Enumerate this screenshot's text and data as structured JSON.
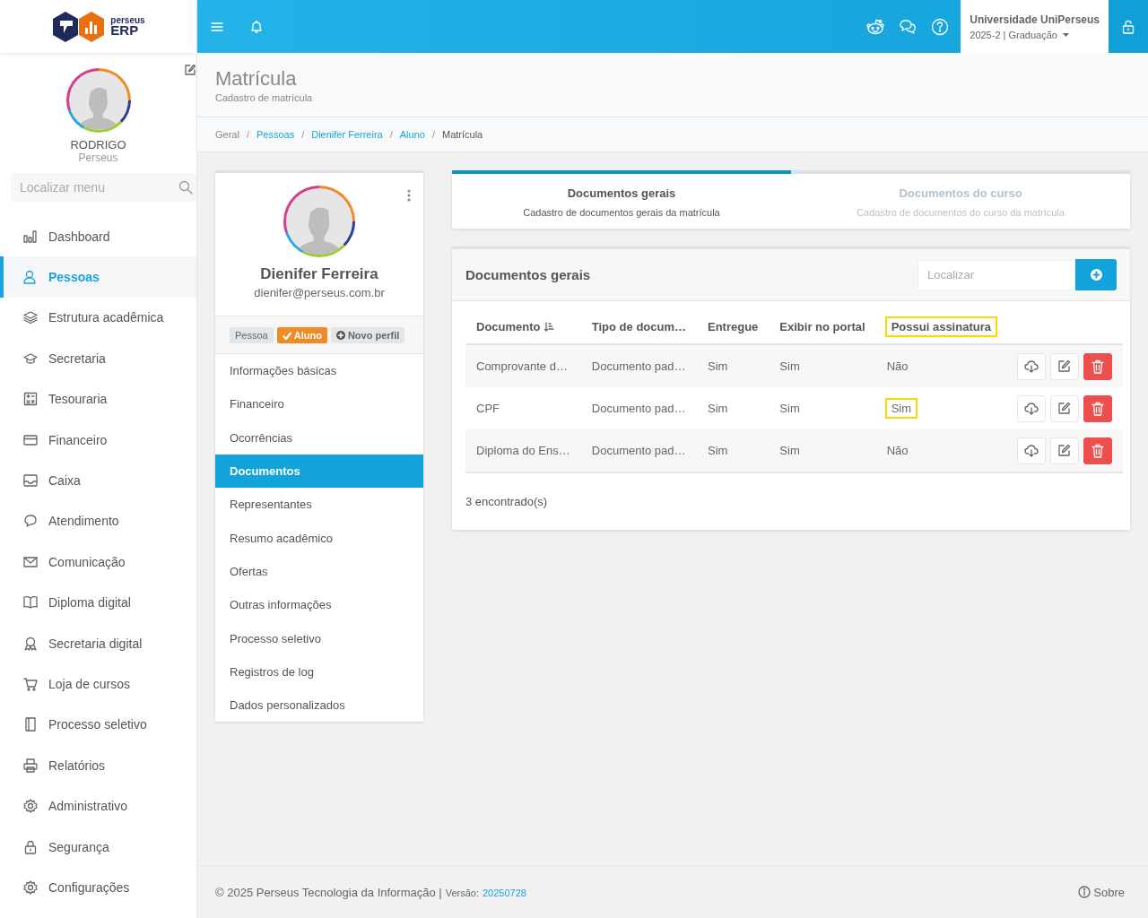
{
  "logo": {
    "small": "perseus",
    "large": "ERP"
  },
  "user": {
    "name": "RODRIGO",
    "org": "Perseus"
  },
  "menu_search": {
    "placeholder": "Localizar menu"
  },
  "menu": [
    {
      "label": "Dashboard",
      "selected": false
    },
    {
      "label": "Pessoas",
      "selected": true
    },
    {
      "label": "Estrutura acadêmica",
      "selected": false
    },
    {
      "label": "Secretaria",
      "selected": false
    },
    {
      "label": "Tesouraria",
      "selected": false
    },
    {
      "label": "Financeiro",
      "selected": false
    },
    {
      "label": "Caixa",
      "selected": false
    },
    {
      "label": "Atendimento",
      "selected": false
    },
    {
      "label": "Comunicação",
      "selected": false
    },
    {
      "label": "Diploma digital",
      "selected": false
    },
    {
      "label": "Secretaria digital",
      "selected": false
    },
    {
      "label": "Loja de cursos",
      "selected": false
    },
    {
      "label": "Processo seletivo",
      "selected": false
    },
    {
      "label": "Relatórios",
      "selected": false
    },
    {
      "label": "Administrativo",
      "selected": false
    },
    {
      "label": "Segurança",
      "selected": false
    },
    {
      "label": "Configurações",
      "selected": false
    }
  ],
  "topbar": {
    "institution": "Universidade UniPerseus",
    "period": "2025-2 | Graduação"
  },
  "page": {
    "title": "Matrícula",
    "subtitle": "Cadastro de matrícula"
  },
  "breadcrumb": {
    "separator": "/",
    "items": [
      {
        "label": "Geral",
        "link": false
      },
      {
        "label": "Pessoas",
        "link": true
      },
      {
        "label": "Dienifer Ferreira",
        "link": true
      },
      {
        "label": "Aluno",
        "link": true
      },
      {
        "label": "Matrícula",
        "link": false
      }
    ]
  },
  "person": {
    "name": "Dienifer Ferreira",
    "email": "dienifer@perseus.com.br",
    "tags": [
      {
        "label": "Pessoa",
        "kind": "plain"
      },
      {
        "label": "Aluno",
        "kind": "active"
      },
      {
        "label": "Novo perfil",
        "kind": "add"
      }
    ],
    "menu": [
      {
        "label": "Informações básicas",
        "selected": false
      },
      {
        "label": "Financeiro",
        "selected": false
      },
      {
        "label": "Ocorrências",
        "selected": false
      },
      {
        "label": "Documentos",
        "selected": true
      },
      {
        "label": "Representantes",
        "selected": false
      },
      {
        "label": "Resumo acadêmico",
        "selected": false
      },
      {
        "label": "Ofertas",
        "selected": false
      },
      {
        "label": "Outras informações",
        "selected": false
      },
      {
        "label": "Processo seletivo",
        "selected": false
      },
      {
        "label": "Registros de log",
        "selected": false
      },
      {
        "label": "Dados personalizados",
        "selected": false
      }
    ]
  },
  "tabs": [
    {
      "title": "Documentos gerais",
      "subtitle": "Cadastro de documentos gerais da matrícula",
      "selected": true
    },
    {
      "title": "Documentos do curso",
      "subtitle": "Cadastro de documentos do curso da matrícula",
      "selected": false
    }
  ],
  "documents": {
    "title": "Documentos gerais",
    "search": {
      "placeholder": "Localizar"
    },
    "columns": [
      {
        "label": "Documento",
        "sortable": true,
        "highlighted": false
      },
      {
        "label": "Tipo de docum…",
        "sortable": false,
        "highlighted": false
      },
      {
        "label": "Entregue",
        "sortable": false,
        "highlighted": false
      },
      {
        "label": "Exibir no portal",
        "sortable": false,
        "highlighted": false
      },
      {
        "label": "Possui assinatura",
        "sortable": false,
        "highlighted": true
      }
    ],
    "rows": [
      {
        "cells": [
          {
            "text": "Comprovante d…",
            "highlighted": false
          },
          {
            "text": "Documento pad…",
            "highlighted": false
          },
          {
            "text": "Sim",
            "highlighted": false
          },
          {
            "text": "Sim",
            "highlighted": false
          },
          {
            "text": "Não",
            "highlighted": false
          }
        ]
      },
      {
        "cells": [
          {
            "text": "CPF",
            "highlighted": false
          },
          {
            "text": "Documento pad…",
            "highlighted": false
          },
          {
            "text": "Sim",
            "highlighted": false
          },
          {
            "text": "Sim",
            "highlighted": false
          },
          {
            "text": "Sim",
            "highlighted": true
          }
        ]
      },
      {
        "cells": [
          {
            "text": "Diploma do Ens…",
            "highlighted": false
          },
          {
            "text": "Documento pad…",
            "highlighted": false
          },
          {
            "text": "Sim",
            "highlighted": false
          },
          {
            "text": "Sim",
            "highlighted": false
          },
          {
            "text": "Não",
            "highlighted": false
          }
        ]
      }
    ],
    "count": "3 encontrado(s)"
  },
  "footer": {
    "copyright": "© 2025 Perseus Tecnologia da Informação |",
    "version_label": "Versão:",
    "version": "20250728",
    "about": "Sobre"
  }
}
